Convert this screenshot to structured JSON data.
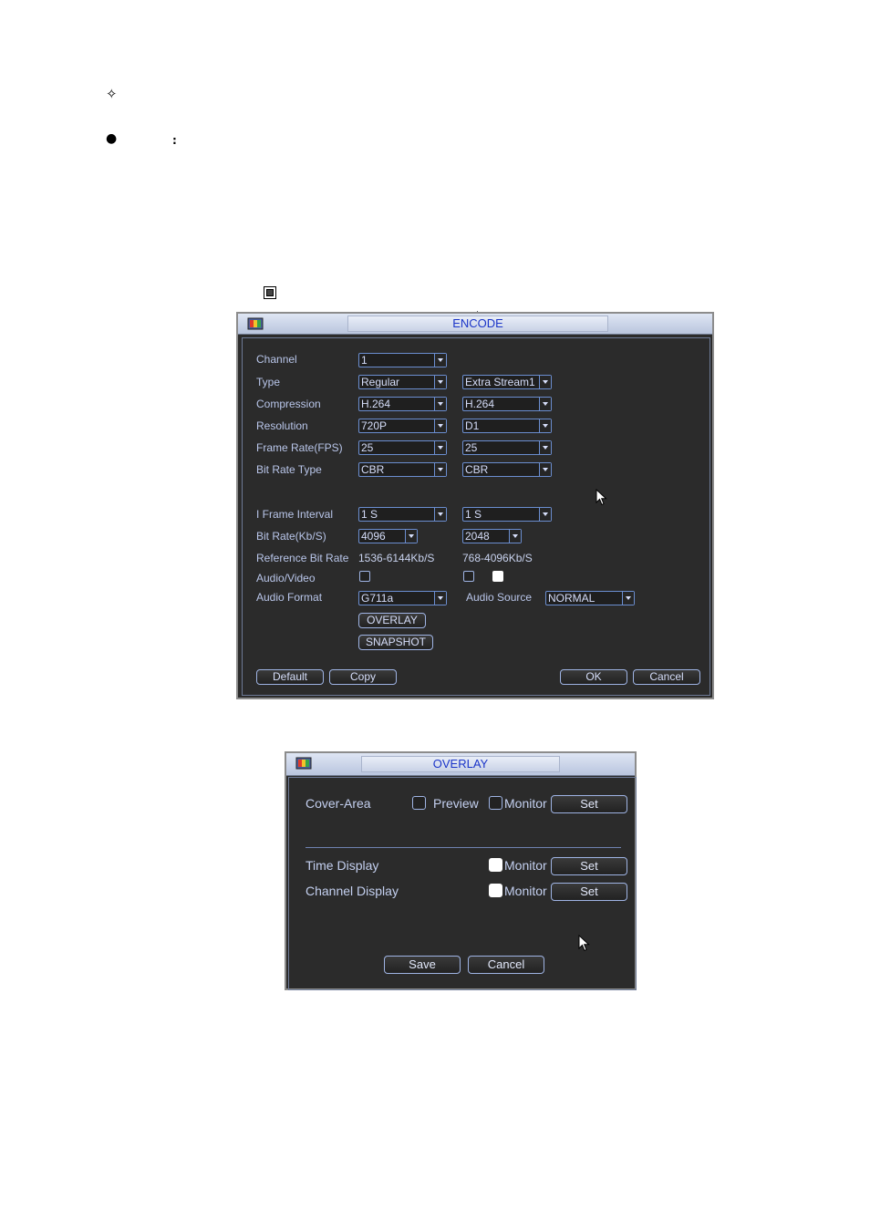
{
  "doc": {
    "star_glyph": "✧",
    "bullet_glyph": "●",
    "colon": ":"
  },
  "encode": {
    "title": "ENCODE",
    "labels": {
      "channel": "Channel",
      "type": "Type",
      "compression": "Compression",
      "resolution": "Resolution",
      "frame_rate": "Frame Rate(FPS)",
      "bit_rate_type": "Bit Rate Type",
      "i_frame_interval": "I Frame Interval",
      "bit_rate": "Bit Rate(Kb/S)",
      "reference_bit_rate": "Reference Bit Rate",
      "audio_video": "Audio/Video",
      "audio_format": "Audio Format",
      "audio_source": "Audio Source"
    },
    "main": {
      "channel": "1",
      "type": "Regular",
      "compression": "H.264",
      "resolution": "720P",
      "frame_rate": "25",
      "bit_rate_type": "CBR",
      "i_frame_interval": "1 S",
      "bit_rate": "4096",
      "reference_bit_rate": "1536-6144Kb/S",
      "audio_format": "G711a"
    },
    "extra": {
      "type": "Extra Stream1",
      "compression": "H.264",
      "resolution": "D1",
      "frame_rate": "25",
      "bit_rate_type": "CBR",
      "i_frame_interval": "1 S",
      "bit_rate": "2048",
      "reference_bit_rate": "768-4096Kb/S"
    },
    "audio_source": "NORMAL",
    "buttons": {
      "overlay": "OVERLAY",
      "snapshot": "SNAPSHOT",
      "default": "Default",
      "copy": "Copy",
      "ok": "OK",
      "cancel": "Cancel"
    }
  },
  "overlay": {
    "title": "OVERLAY",
    "cover_area": "Cover-Area",
    "preview": "Preview",
    "monitor": "Monitor",
    "set": "Set",
    "time_display": "Time Display",
    "channel_display": "Channel Display",
    "save": "Save",
    "cancel": "Cancel"
  },
  "colors": {
    "window_bg": "#2b2b2b",
    "label_text": "#b9c6ea",
    "title_text": "#1a34c8",
    "control_border": "#6b8ed0"
  }
}
